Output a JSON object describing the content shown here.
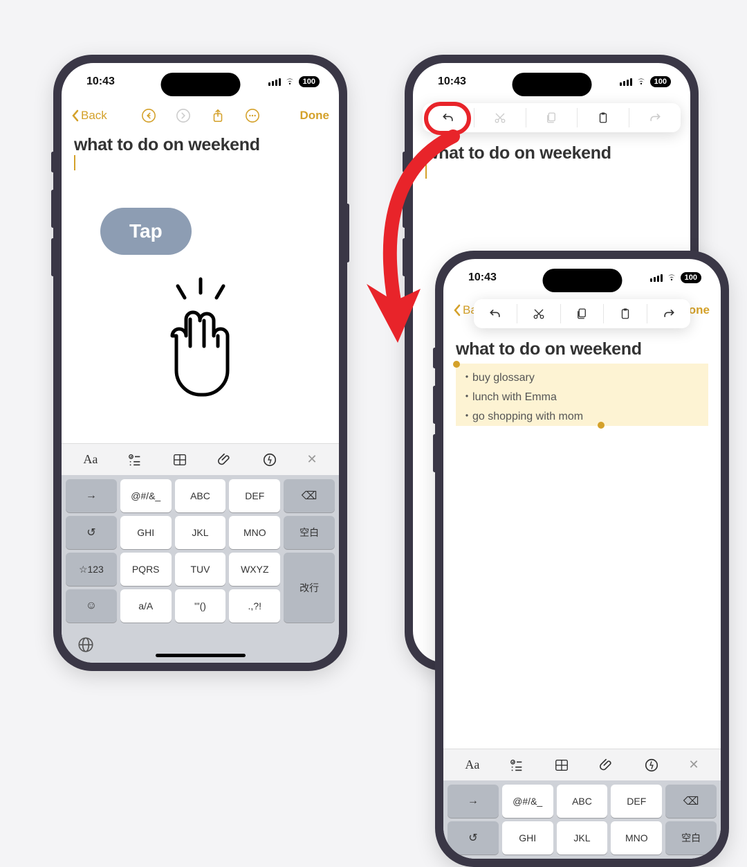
{
  "status": {
    "time": "10:43",
    "battery": "100"
  },
  "nav": {
    "back": "Back",
    "done": "Done"
  },
  "note": {
    "title": "what to do on weekend",
    "bullets": [
      "buy glossary",
      "lunch with Emma",
      "go shopping with mom"
    ]
  },
  "tap_label": "Tap",
  "keyboard": {
    "keys": [
      "@#/&_",
      "ABC",
      "DEF",
      "GHI",
      "JKL",
      "MNO",
      "PQRS",
      "TUV",
      "WXYZ",
      "a/A",
      "'\"()",
      ".,?!"
    ],
    "space": "空白",
    "enter": "改行",
    "nums": "☆123"
  },
  "fmt": {
    "aa": "Aa"
  }
}
